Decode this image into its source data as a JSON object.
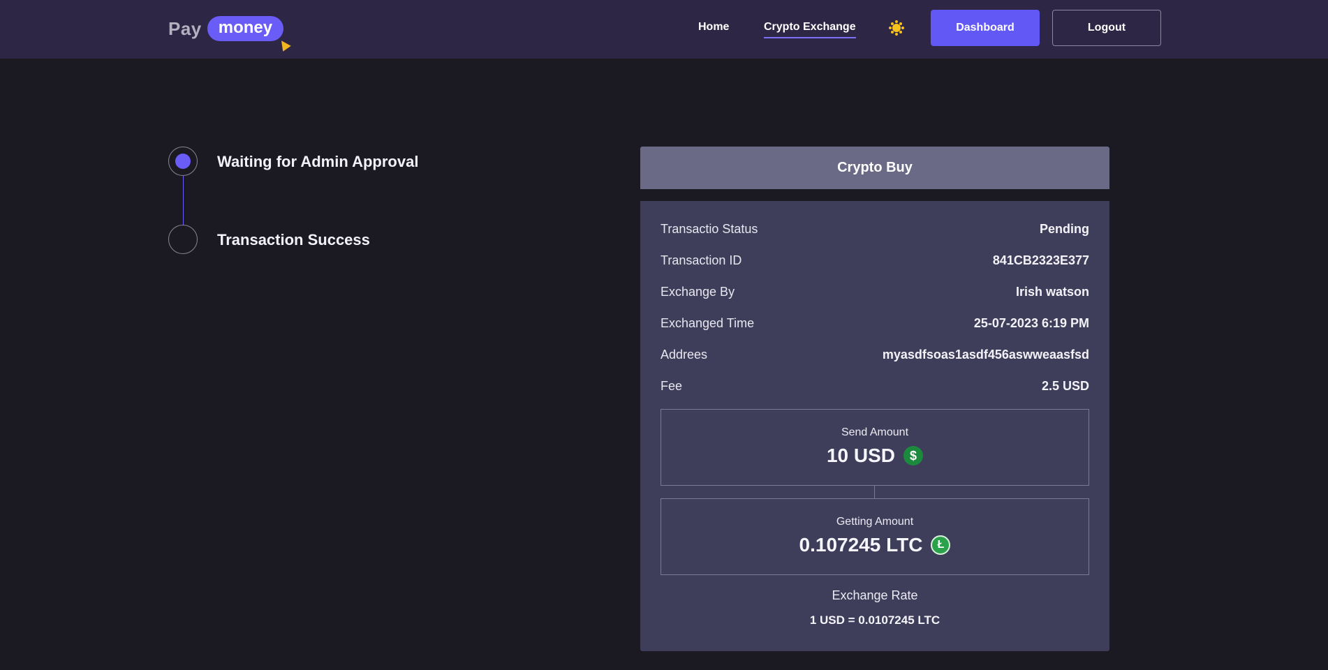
{
  "header": {
    "logo": {
      "pay": "Pay",
      "money": "money"
    },
    "nav": {
      "home": "Home",
      "crypto_exchange": "Crypto Exchange"
    },
    "theme_icon": "sun-icon",
    "dashboard_label": "Dashboard",
    "logout_label": "Logout"
  },
  "steps": [
    {
      "label": "Waiting for Admin Approval",
      "active": true
    },
    {
      "label": "Transaction Success",
      "active": false
    }
  ],
  "card": {
    "title": "Crypto Buy",
    "rows": [
      {
        "label": "Transactio Status",
        "value": "Pending"
      },
      {
        "label": "Transaction ID",
        "value": "841CB2323E377"
      },
      {
        "label": "Exchange By",
        "value": "Irish watson"
      },
      {
        "label": "Exchanged Time",
        "value": "25-07-2023 6:19 PM"
      },
      {
        "label": "Addrees",
        "value": "myasdfsoas1asdf456aswweaasfsd"
      },
      {
        "label": "Fee",
        "value": "2.5 USD"
      }
    ],
    "send": {
      "label": "Send Amount",
      "value": "10 USD",
      "icon": "usd-coin-icon",
      "icon_glyph": "$"
    },
    "getting": {
      "label": "Getting Amount",
      "value": "0.107245 LTC",
      "icon": "ltc-coin-icon",
      "icon_glyph": "Ł"
    },
    "exchange_rate_label": "Exchange Rate",
    "exchange_rate_value": "1 USD = 0.0107245 LTC"
  },
  "colors": {
    "accent": "#6a5cf6",
    "header_bg": "#2d2645",
    "page_bg": "#1b1922",
    "card_bg": "#3f3e5a",
    "card_head_bg": "#6b6a86"
  }
}
